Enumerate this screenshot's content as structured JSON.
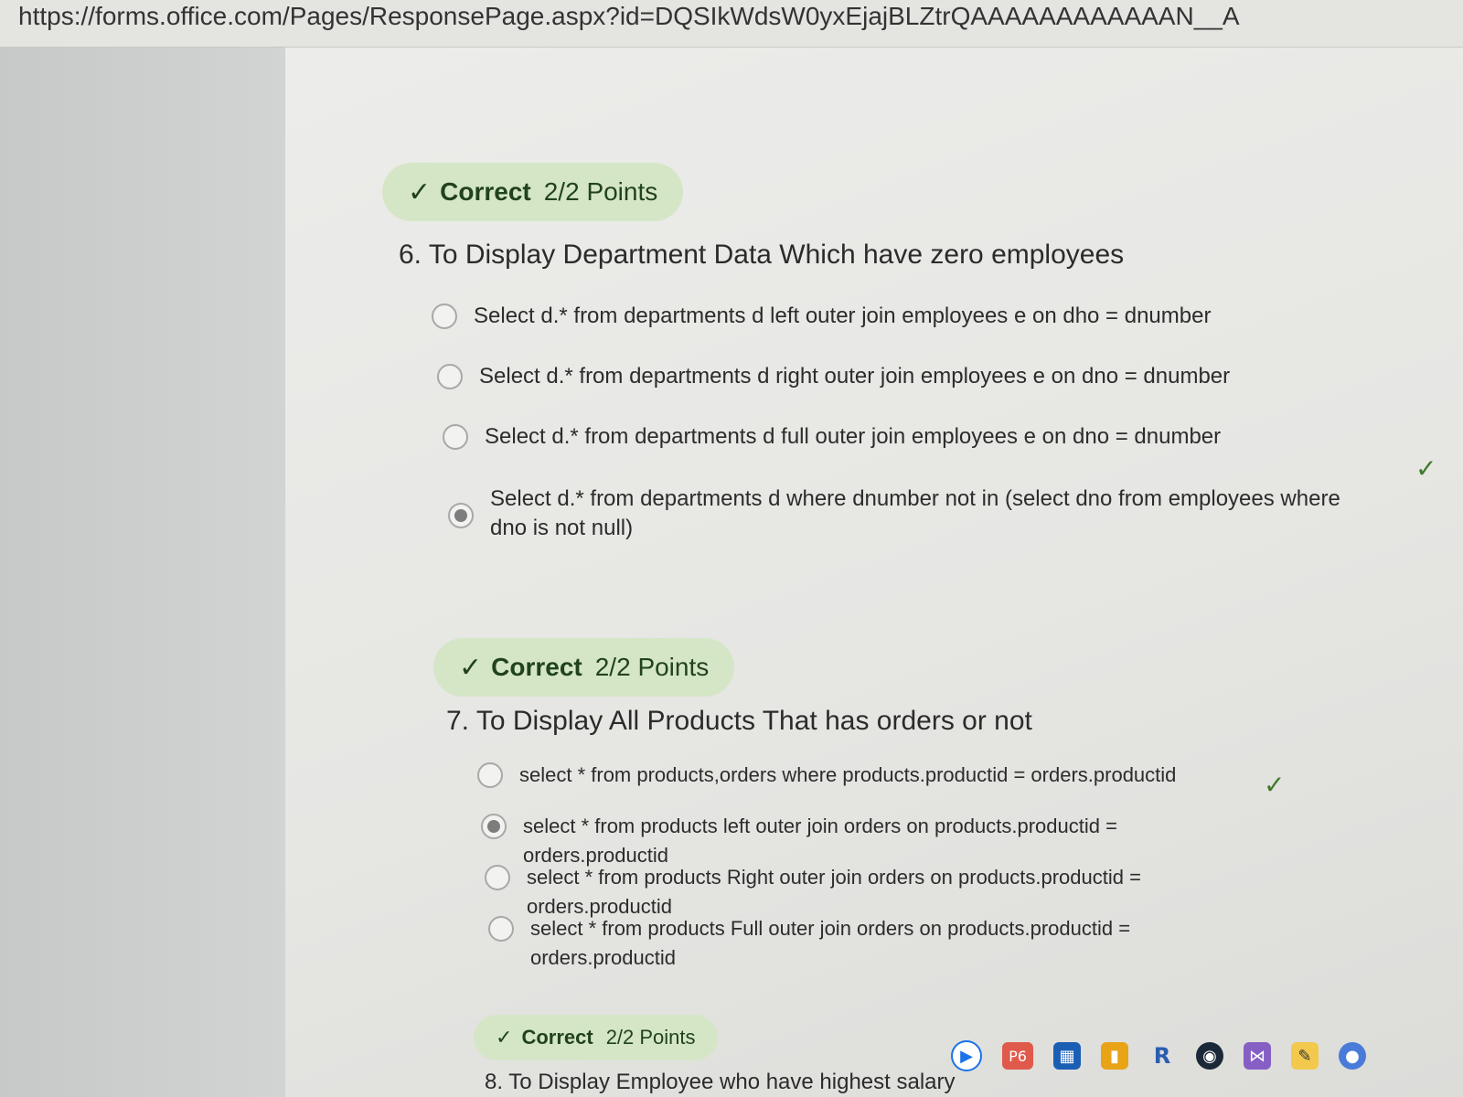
{
  "browser": {
    "url": "https://forms.office.com/Pages/ResponsePage.aspx?id=DQSIkWdsW0yxEjajBLZtrQAAAAAAAAAAAAN__A"
  },
  "questions": [
    {
      "badge": {
        "status": "Correct",
        "points": "2/2 Points"
      },
      "title": "6. To Display Department Data Which have zero employees",
      "options": [
        {
          "text": "Select d.* from departments d left outer join employees e on dho = dnumber",
          "selected": false
        },
        {
          "text": "Select d.* from departments d right outer join employees e on dno = dnumber",
          "selected": false
        },
        {
          "text": "Select d.* from departments d full outer join employees e on dno = dnumber",
          "selected": false
        },
        {
          "text": "Select d.* from departments d where dnumber not in (select dno from employees where dno is not null)",
          "selected": true
        }
      ],
      "correct_option": 4
    },
    {
      "badge": {
        "status": "Correct",
        "points": "2/2 Points"
      },
      "title": "7. To Display All Products That has orders or not",
      "options": [
        {
          "text": "select * from products,orders where products.productid = orders.productid",
          "selected": false
        },
        {
          "text": "select * from products left outer join orders on products.productid = orders.productid",
          "selected": true
        },
        {
          "text": "select * from products Right outer join orders on products.productid = orders.productid",
          "selected": false
        },
        {
          "text": "select * from products Full outer join orders on products.productid = orders.productid",
          "selected": false
        }
      ],
      "correct_option": 2
    },
    {
      "badge": {
        "status": "Correct",
        "points": "2/2 Points"
      },
      "title": "8. To Display Employee who have highest salary"
    }
  ],
  "icons": {
    "check": "✓",
    "pill_check": "checkmark-icon",
    "correct_mark": "correct-answer-checkmark-icon"
  },
  "taskbar": {
    "p6_label": "P6",
    "r_label": "R"
  },
  "colors": {
    "pill_bg": "#d5e6c7",
    "pill_text": "#21431c",
    "tick": "#3f7a2a"
  }
}
